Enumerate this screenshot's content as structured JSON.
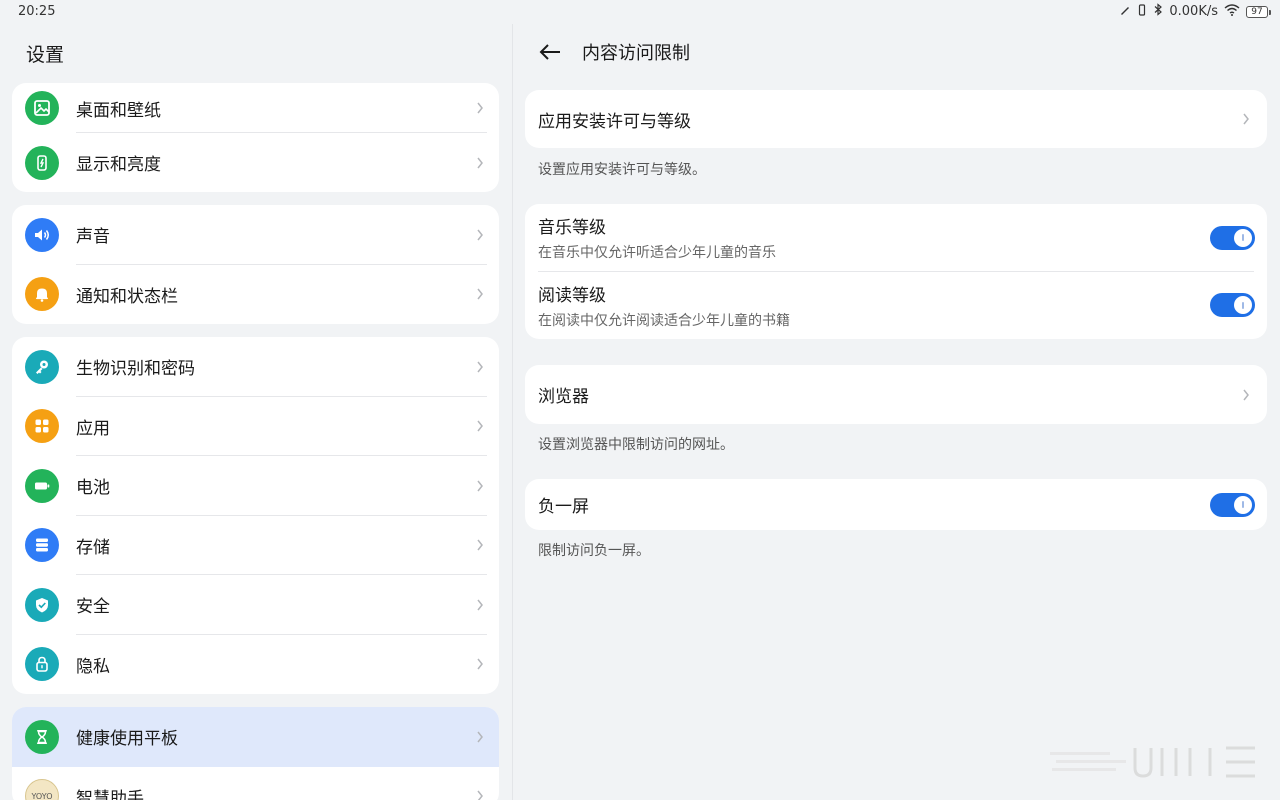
{
  "status_bar": {
    "time": "20:25",
    "net_speed": "0.00K/s",
    "battery": "97"
  },
  "left": {
    "title": "设置",
    "groups": [
      {
        "items": [
          {
            "label": "桌面和壁纸",
            "icon": "wallpaper-icon",
            "color": "#23b35a"
          },
          {
            "label": "显示和亮度",
            "icon": "display-brightness-icon",
            "color": "#23b35a"
          }
        ]
      },
      {
        "items": [
          {
            "label": "声音",
            "icon": "sound-icon",
            "color": "#2f7cf6"
          },
          {
            "label": "通知和状态栏",
            "icon": "notification-bell-icon",
            "color": "#f5a013"
          }
        ]
      },
      {
        "items": [
          {
            "label": "生物识别和密码",
            "icon": "key-icon",
            "color": "#1aaab8"
          },
          {
            "label": "应用",
            "icon": "apps-grid-icon",
            "color": "#f5a013"
          },
          {
            "label": "电池",
            "icon": "battery-icon",
            "color": "#23b35a"
          },
          {
            "label": "存储",
            "icon": "storage-icon",
            "color": "#2f7cf6"
          },
          {
            "label": "安全",
            "icon": "security-shield-icon",
            "color": "#1aaab8"
          },
          {
            "label": "隐私",
            "icon": "privacy-lock-icon",
            "color": "#1aaab8"
          }
        ]
      },
      {
        "items": [
          {
            "label": "健康使用平板",
            "icon": "hourglass-icon",
            "color": "#23b35a",
            "selected": true
          },
          {
            "label": "智慧助手",
            "icon": "yoyo-assistant-icon",
            "color": "#f3e6c4",
            "icon_text": "YOYO"
          }
        ]
      }
    ]
  },
  "right": {
    "title": "内容访问限制",
    "app_install": {
      "label": "应用安装许可与等级",
      "note": "设置应用安装许可与等级。"
    },
    "music": {
      "label": "音乐等级",
      "sub": "在音乐中仅允许听适合少年儿童的音乐",
      "enabled": true
    },
    "reading": {
      "label": "阅读等级",
      "sub": "在阅读中仅允许阅读适合少年儿童的书籍",
      "enabled": true
    },
    "browser": {
      "label": "浏览器",
      "note": "设置浏览器中限制访问的网址。"
    },
    "minus_one": {
      "label": "负一屏",
      "note": "限制访问负一屏。",
      "enabled": true
    }
  },
  "colors": {
    "accent": "#1f6fe6",
    "selected_row": "#dfe8fb",
    "background": "#f1f3f5"
  }
}
